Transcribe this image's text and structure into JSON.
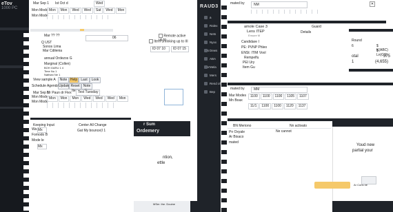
{
  "left_panel": {
    "logo_text": "eTov",
    "logo_sub": "1000 PC"
  },
  "calendar_top": {
    "label_left": "Mar Sep 1",
    "month_label": "Ist Oct d",
    "days": [
      "Mon",
      "Wed",
      "Sat",
      "Wed",
      "Mon"
    ],
    "sidebar_labels": [
      "Mon Mode",
      "Mon Mode"
    ],
    "row_days": [
      "Mon",
      "Mon",
      "Wed",
      "Wed",
      "Sat",
      "Wed",
      "Mon"
    ]
  },
  "form_section": {
    "title": "Mar ?? ??",
    "field_value": "06",
    "checkbox1": "Remote active up to",
    "checkbox2": "Item shrinking up to III",
    "date_left": "ID 07 10",
    "date_right": "ID 07 15",
    "labels": [
      "Q UST",
      "Sonos Lima",
      "Mar Cdilenia"
    ],
    "selected_label": "annual Ordezos G",
    "sub_labels": [
      "Marginal (Collen)",
      "BOH GARU 1 4",
      "Time Nu 1",
      "Nathian Ne 1",
      "Mar Mode 1"
    ],
    "toolbar_label": "View sample A",
    "toolbar_buttons": [
      "Note",
      "Help",
      "Last",
      "Look"
    ],
    "second_toolbar_label": "Schedule Agenda ore",
    "second_toolbar_buttons": [
      "Update",
      "Reset Item",
      "Note No"
    ]
  },
  "calendar_bottom": {
    "label_left": "Mar Sep 1",
    "sidebar_labels": [
      "Mon Mode",
      "Mon Mode"
    ],
    "header_cells": [
      "Mr Paun dr Flex",
      "Test Tuesday"
    ],
    "row_days": [
      "Mon",
      "Mon",
      "Mon",
      "Wed",
      "Wed",
      "Wed",
      "Mon"
    ]
  },
  "lower_left": {
    "search_label": "Keeping Input",
    "center_text": "Center All Change",
    "sub_center": "Gat My bounce(I 1",
    "field1": "Wa",
    "field2": "Fomodo B",
    "field3": "Mode le",
    "values": [
      "Mx",
      "Mx"
    ]
  },
  "dark_card": {
    "title": "r Sum",
    "subtitle": "Ordemery",
    "body1": "ntion,",
    "body2": "ettle",
    "footer": "MSer. the. Douine"
  },
  "app_sidebar": {
    "brand": "RAUD3",
    "items": [
      "a",
      "Ralex",
      "Nets",
      "Nyxx Mis",
      "Dews",
      "ABA Mer",
      "Mela",
      "Mers",
      "Rend of",
      "Bep",
      "Cam Data",
      "Ob",
      "Condition",
      "Dirty Ap",
      "Ob"
    ]
  },
  "app_main": {
    "header_label": "mated by",
    "header_value": "NM",
    "section_title": "amole Case 3",
    "section_sub": "Lens ITEP",
    "section_detail": "Ensure M",
    "right_label": "Guard",
    "right_label2": "Details",
    "list_items": [
      "Candidare I",
      "PE: PVNP Phleo",
      "ENSt: ITIM Vool",
      "Rempelfu",
      "PEI Ury",
      "Item Gu"
    ],
    "totals_label": "Total",
    "totals": [
      "Round",
      "$ K(ABC)",
      "$ Ln(GS)",
      "otal",
      "1"
    ],
    "totals_values": [
      "6",
      "375",
      "(4,655)"
    ],
    "second_header_label": "mated by",
    "second_header_value": "MM",
    "second_rows": [
      "Mar Modes",
      "Mn Boax"
    ],
    "cells": [
      "1100",
      "1100",
      "1100",
      "1105",
      "1107"
    ],
    "footer_cells": [
      "11/1",
      "1100",
      "1100",
      "1120",
      "1137"
    ]
  },
  "bottom_table": {
    "col1": "BN Meriono",
    "col2": "Nn activato",
    "col2b": "Ne cannot",
    "col3": "Pn Oxyale",
    "col4": "Ar Bixaco",
    "row_label": "mated"
  },
  "dialog": {
    "line1": "Youd new",
    "line2": "partial your",
    "primary_button": "",
    "secondary_label": "Ma ON",
    "secondary_label2": "Ar Cons Ite"
  },
  "colors": {
    "dark_bg": "#1f2329",
    "accent": "#f5c96a",
    "panel_bg": "#ffffff"
  }
}
